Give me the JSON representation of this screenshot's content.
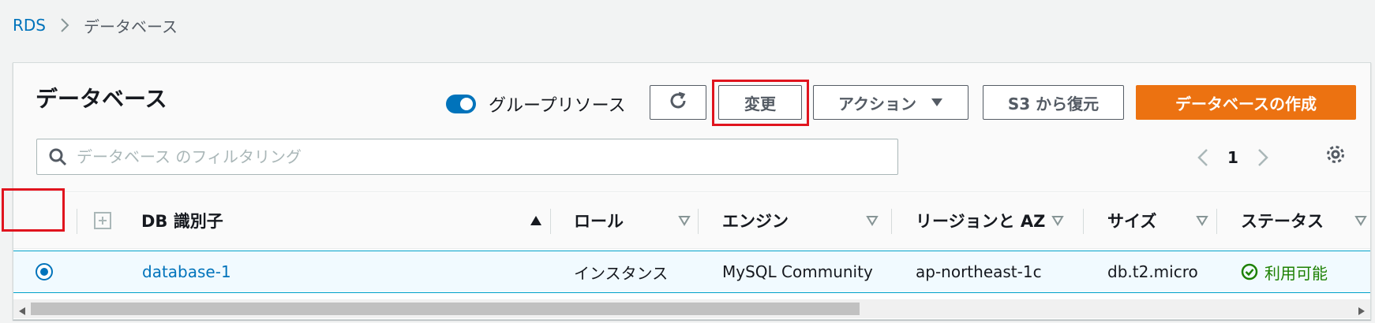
{
  "breadcrumb": {
    "root": "RDS",
    "current": "データベース"
  },
  "panel": {
    "title": "データベース",
    "group_toggle_label": "グループリソース",
    "buttons": {
      "modify": "変更",
      "actions": "アクション",
      "restore": "S3 から復元",
      "create": "データベースの作成"
    },
    "search_placeholder": "データベース のフィルタリング",
    "page_number": "1"
  },
  "table": {
    "columns": [
      "DB 識別子",
      "ロール",
      "エンジン",
      "リージョンと AZ",
      "サイズ",
      "ステータス"
    ],
    "rows": [
      {
        "identifier": "database-1",
        "role": "インスタンス",
        "engine": "MySQL Community",
        "region": "ap-northeast-1c",
        "size": "db.t2.micro",
        "status": "利用可能"
      }
    ]
  },
  "colors": {
    "primary": "#ec7211",
    "link": "#0073bb",
    "status_ok": "#1d8102",
    "highlight": "#e0141e"
  }
}
